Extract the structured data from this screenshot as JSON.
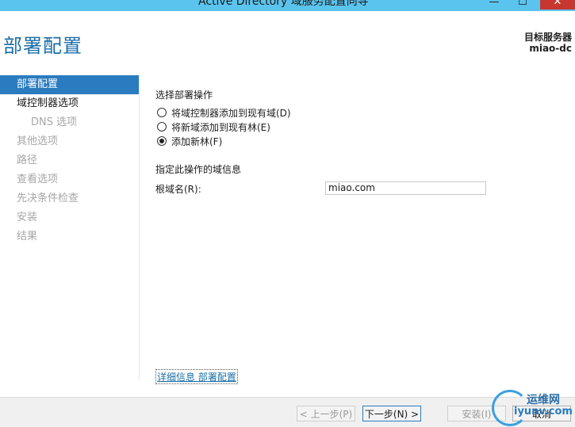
{
  "window": {
    "title": "Active Directory 域服务配置向导",
    "minimize": "—",
    "maximize": "☐",
    "close": "✕"
  },
  "page": {
    "title": "部署配置"
  },
  "target_server": {
    "label": "目标服务器",
    "name": "miao-dc"
  },
  "nav": [
    {
      "label": "部署配置",
      "state": "active"
    },
    {
      "label": "域控制器选项",
      "state": "normal"
    },
    {
      "label": "DNS 选项",
      "state": "sub-disabled"
    },
    {
      "label": "其他选项",
      "state": "disabled"
    },
    {
      "label": "路径",
      "state": "disabled"
    },
    {
      "label": "查看选项",
      "state": "disabled"
    },
    {
      "label": "先决条件检查",
      "state": "disabled"
    },
    {
      "label": "安装",
      "state": "disabled"
    },
    {
      "label": "结果",
      "state": "disabled"
    }
  ],
  "operation": {
    "heading": "选择部署操作",
    "options": [
      {
        "label": "将域控制器添加到现有域(D)",
        "checked": false
      },
      {
        "label": "将新域添加到现有林(E)",
        "checked": false
      },
      {
        "label": "添加新林(F)",
        "checked": true
      }
    ]
  },
  "domain_info": {
    "heading": "指定此操作的域信息",
    "root_label": "根域名(R):",
    "root_value": "miao.com"
  },
  "more_info_link": "详细信息 部署配置",
  "buttons": {
    "prev": "< 上一步(P)",
    "next": "下一步(N) >",
    "install": "安装(I)",
    "cancel": "取消"
  },
  "watermark": {
    "name": "运维网",
    "domain": "iyunv.com"
  }
}
